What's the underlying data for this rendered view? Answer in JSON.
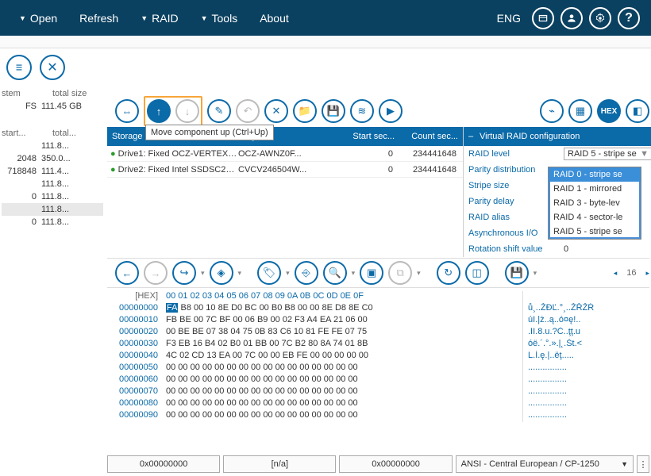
{
  "menu": {
    "open": "Open",
    "refresh": "Refresh",
    "raid": "RAID",
    "tools": "Tools",
    "about": "About",
    "lang": "ENG"
  },
  "tooltip": "Move component up (Ctrl+Up)",
  "left": {
    "h1": "stem",
    "h2": "total size",
    "fs": "FS",
    "fssize": "111.45 GB",
    "h3": "start...",
    "h4": "total...",
    "rows": [
      {
        "a": "",
        "b": "111.8..."
      },
      {
        "a": "2048",
        "b": "350.0..."
      },
      {
        "a": "718848",
        "b": "111.4..."
      },
      {
        "a": "",
        "b": "111.8..."
      },
      {
        "a": "0",
        "b": "111.8..."
      },
      {
        "a": "",
        "b": "111.8..."
      },
      {
        "a": "0",
        "b": "111.8..."
      }
    ]
  },
  "grid": {
    "hdr": {
      "storage": "Storage",
      "sid": "rage ID",
      "start": "Start sec...",
      "count": "Count sec..."
    },
    "drives": [
      {
        "name": "Drive1: Fixed OCZ-VERTEX3 (...",
        "sid": "OCZ-AWNZ0F...",
        "start": "0",
        "count": "234441648"
      },
      {
        "name": "Drive2: Fixed Intel SSDSC2BW...",
        "sid": "CVCV246504W...",
        "start": "0",
        "count": "234441648"
      }
    ]
  },
  "raid": {
    "title": "Virtual RAID configuration",
    "rows": [
      {
        "lbl": "RAID level",
        "val": "RAID 5 - stripe se"
      },
      {
        "lbl": "Parity distribution",
        "val": ""
      },
      {
        "lbl": "Stripe size",
        "val": ""
      },
      {
        "lbl": "Parity delay",
        "val": ""
      },
      {
        "lbl": "RAID alias",
        "val": ""
      },
      {
        "lbl": "Asynchronous I/O",
        "val": ""
      },
      {
        "lbl": "Rotation shift value",
        "val": "0"
      }
    ],
    "options": [
      "RAID 0 - stripe se",
      "RAID 1 - mirrored",
      "RAID 3 - byte-lev",
      "RAID 4 - sector-le",
      "RAID 5 - stripe se"
    ]
  },
  "hex": {
    "label": "[HEX]",
    "cols": "00 01 02 03 04 05 06 07 08 09 0A 0B 0C 0D 0E 0F",
    "page": "16",
    "offsets": [
      "00000000",
      "00000010",
      "00000020",
      "00000030",
      "00000040",
      "00000050",
      "00000060",
      "00000070",
      "00000080",
      "00000090"
    ],
    "rows": [
      "FA B8 00 10 8E D0 BC 00 B0 B8 00 00 8E D8 8E C0",
      "FB BE 00 7C BF 00 06 B9 00 02 F3 A4 EA 21 06 00",
      "00 BE BE 07 38 04 75 0B 83 C6 10 81 FE FE 07 75",
      "F3 EB 16 B4 02 B0 01 BB 00 7C B2 80 8A 74 01 8B",
      "4C 02 CD 13 EA 00 7C 00 00 EB FE 00 00 00 00 00",
      "00 00 00 00 00 00 00 00 00 00 00 00 00 00 00 00",
      "00 00 00 00 00 00 00 00 00 00 00 00 00 00 00 00",
      "00 00 00 00 00 00 00 00 00 00 00 00 00 00 00 00",
      "00 00 00 00 00 00 00 00 00 00 00 00 00 00 00 00",
      "00 00 00 00 00 00 00 00 00 00 00 00 00 00 00 00"
    ],
    "ascii": [
      "ů¸..ŽĐĽ.°¸..ŽŘŽŔ",
      "úI.|ż..ą..ó¤ę!..",
      ".II.8.u.?Ć..ţţ.u",
      "óë.´.°.».|˛.Št.<",
      "L.Í.ę.|..ëţ.....",
      "................",
      "................",
      "................",
      "................",
      "................"
    ]
  },
  "status": {
    "off1": "0x00000000",
    "na": "[n/a]",
    "off2": "0x00000000",
    "enc": "ANSI - Central European / CP-1250"
  }
}
